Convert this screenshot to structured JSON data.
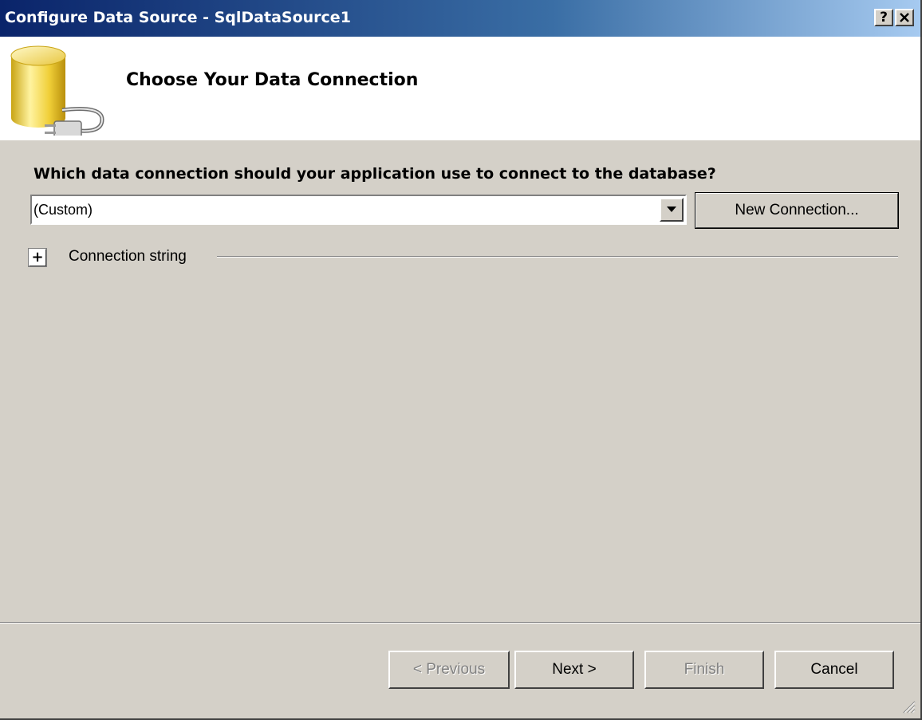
{
  "window": {
    "title": "Configure Data Source - SqlDataSource1",
    "help_button": "?",
    "close_button": "✕"
  },
  "header": {
    "title": "Choose Your Data Connection",
    "icon": "database-plug-icon"
  },
  "connection": {
    "question": "Which data connection should your application use to connect to the database?",
    "selected_value": "(Custom)",
    "new_connection_label": "New Connection...",
    "expander_symbol": "+",
    "connection_string_label": "Connection string"
  },
  "footer": {
    "previous_label": "< Previous",
    "next_label": "Next >",
    "finish_label": "Finish",
    "cancel_label": "Cancel"
  },
  "colors": {
    "dialog_bg": "#d4d0c8",
    "titlebar_start": "#0a246a",
    "titlebar_end": "#a6caf0",
    "header_bg": "#ffffff",
    "disabled_text": "#808080"
  }
}
